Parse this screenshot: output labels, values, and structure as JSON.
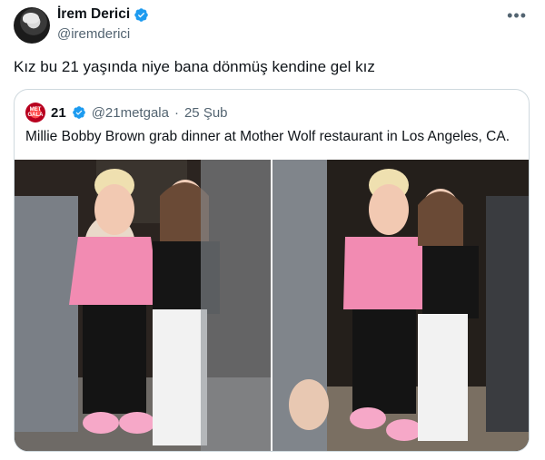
{
  "author": {
    "display_name": "İrem Derici",
    "handle": "@iremderici",
    "avatar_icon": "profile-photo",
    "verified": true
  },
  "more_label": "•••",
  "tweet_text": "Kız bu 21 yaşında niye bana dönmüş kendine gel kız",
  "quoted": {
    "avatar_text": "MET GALA",
    "display_name": "21",
    "handle": "@21metgala",
    "separator": "·",
    "date": "25 Şub",
    "verified": true,
    "text": "Millie Bobby Brown grab dinner at Mother Wolf restaurant in Los Angeles, CA."
  },
  "colors": {
    "verified_blue": "#1d9bf0",
    "muted_text": "#536471",
    "border": "#cfd9de"
  }
}
